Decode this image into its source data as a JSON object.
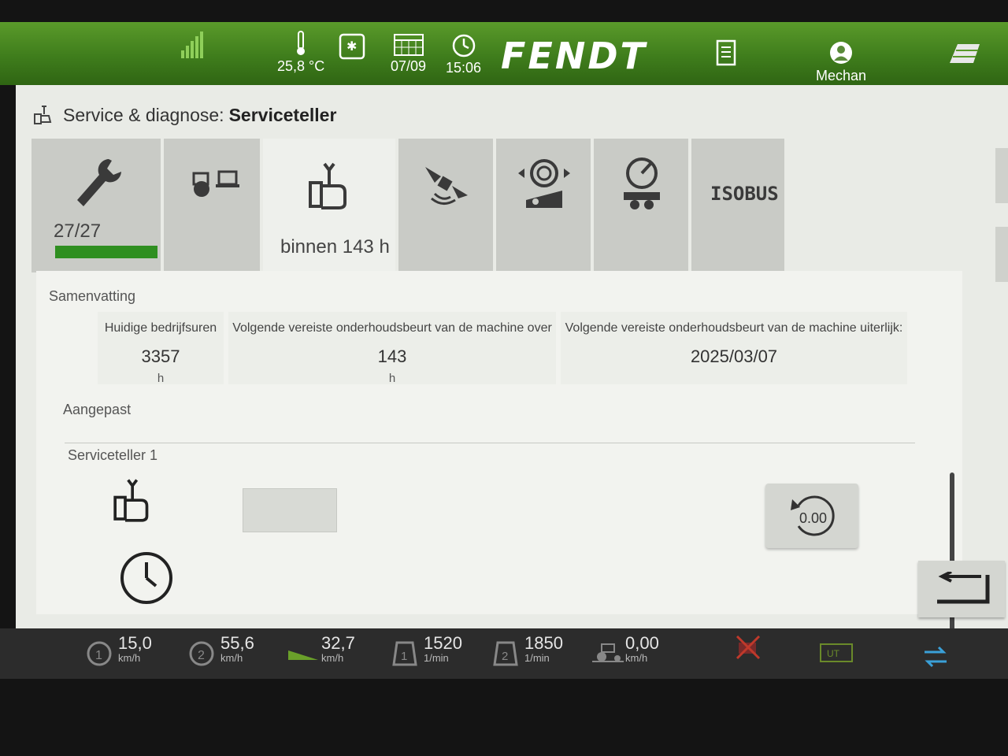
{
  "topbar": {
    "temperature": "25,8 °C",
    "date": "07/09",
    "time": "15:06",
    "brand": "FENDT",
    "user": "Mechan"
  },
  "header": {
    "section": "Service & diagnose:",
    "page": "Serviceteller"
  },
  "tabs": [
    {
      "name": "service",
      "text": "27/27",
      "progress": 1.0
    },
    {
      "name": "diagnose",
      "text": ""
    },
    {
      "name": "serviceteller",
      "text": "binnen 143 h"
    },
    {
      "name": "gps",
      "text": ""
    },
    {
      "name": "tyre-pressure",
      "text": ""
    },
    {
      "name": "brake-trailer",
      "text": ""
    },
    {
      "name": "isobus",
      "text": "ISOBUS"
    }
  ],
  "summary": {
    "title": "Samenvatting",
    "operating_hours": {
      "label": "Huidige bedrijfsuren",
      "value": "3357",
      "unit": "h"
    },
    "next_service_in": {
      "label": "Volgende vereiste onderhoudsbeurt van de machine over",
      "value": "143",
      "unit": "h"
    },
    "next_service_by": {
      "label": "Volgende vereiste onderhoudsbeurt van de machine uiterlijk:",
      "value": "2025/03/07"
    }
  },
  "adjusted_title": "Aangepast",
  "counter": {
    "title": "Serviceteller 1",
    "reset_value": "0.00"
  },
  "bottombar": [
    {
      "value": "15,0",
      "unit": "km/h"
    },
    {
      "value": "55,6",
      "unit": "km/h"
    },
    {
      "value": "32,7",
      "unit": "km/h"
    },
    {
      "value": "1520",
      "unit": "1/min"
    },
    {
      "value": "1850",
      "unit": "1/min"
    },
    {
      "value": "0,00",
      "unit": "km/h"
    }
  ],
  "colors": {
    "topbar_green": "#3f7d1c",
    "progress_green": "#2f8f20",
    "accent_blue": "#2a7fd4"
  }
}
